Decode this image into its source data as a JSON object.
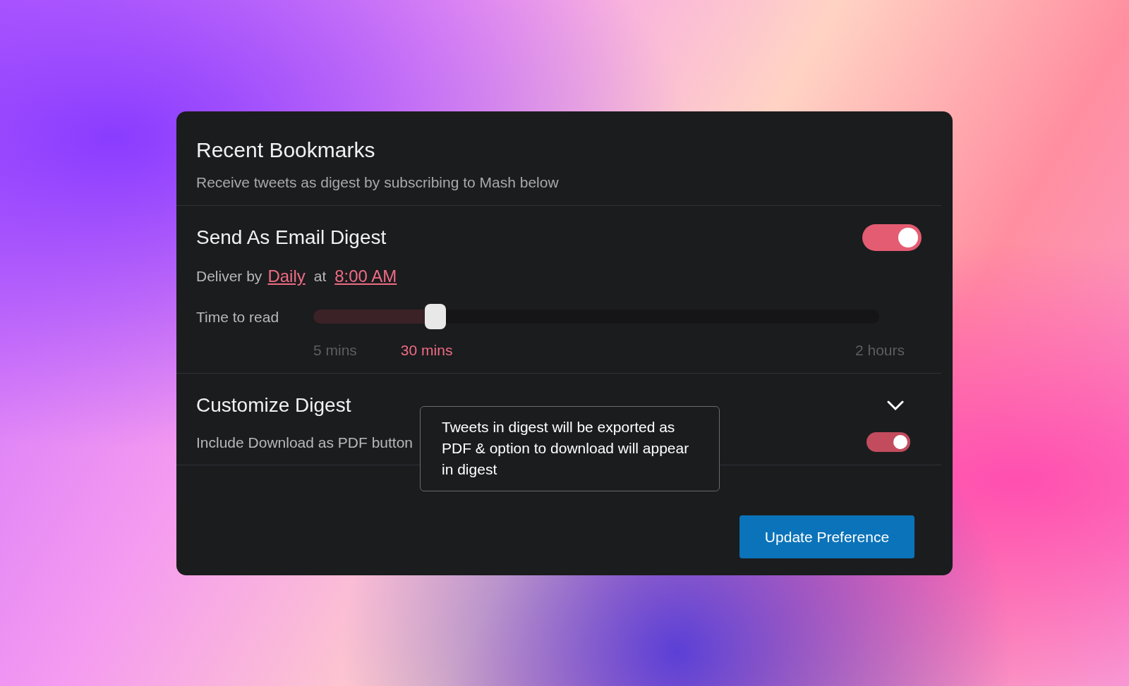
{
  "header": {
    "title": "Recent Bookmarks",
    "subtitle": "Receive tweets as digest by subscribing to Mash below"
  },
  "email_digest": {
    "title": "Send As Email Digest",
    "on": true,
    "delivery": {
      "prefix": "Deliver by",
      "frequency": "Daily",
      "joiner": "at",
      "time": "8:00 AM"
    },
    "time_to_read": {
      "label": "Time to read",
      "level": 0.216,
      "ticks": [
        {
          "label": "5 mins",
          "selected": false
        },
        {
          "label": "30 mins",
          "selected": true
        },
        {
          "label": "2 hours",
          "selected": false
        }
      ]
    }
  },
  "customize": {
    "title": "Customize Digest",
    "option": {
      "label": "Include Download as PDF button",
      "on": true
    },
    "tooltip": "Tweets in digest will be exported as PDF & option to download will appear in digest"
  },
  "button": "Update Preference"
}
